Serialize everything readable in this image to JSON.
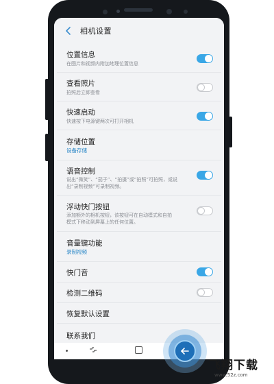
{
  "header": {
    "title": "相机设置"
  },
  "settings": [
    {
      "title": "位置信息",
      "subtitle": "在图片和视频内附加地理位置信息",
      "toggle": true
    },
    {
      "title": "查看照片",
      "subtitle": "拍照后立即查看",
      "toggle": false
    },
    {
      "title": "快速启动",
      "subtitle": "快速按下电源键两次可打开相机",
      "toggle": true
    },
    {
      "title": "存储位置",
      "value": "设备存储"
    },
    {
      "title": "语音控制",
      "subtitle_line1": "说出“微笑”、“茄子”、“拍摄”或“拍照”可拍照，或说",
      "subtitle_line2": "出“录制视频”可录制视频。",
      "toggle": true
    },
    {
      "title": "浮动快门按钮",
      "subtitle_line1": "添加额外的相机按钮，该按钮可在自动模式和自拍",
      "subtitle_line2": "模式下移动到屏幕上的任何位置。",
      "toggle": false
    },
    {
      "title": "音量键功能",
      "value": "录制视频"
    },
    {
      "title": "快门音",
      "toggle": true
    },
    {
      "title": "检测二维码",
      "toggle": false
    },
    {
      "title": "恢复默认设置"
    },
    {
      "title": "联系我们"
    }
  ],
  "watermark": {
    "logo": "飞翔下载",
    "url": "www.52z.com"
  },
  "colors": {
    "accent": "#3aa7e6",
    "link": "#2a87c7",
    "screen_bg": "#f2f3f5",
    "phone_body": "#15181c"
  }
}
